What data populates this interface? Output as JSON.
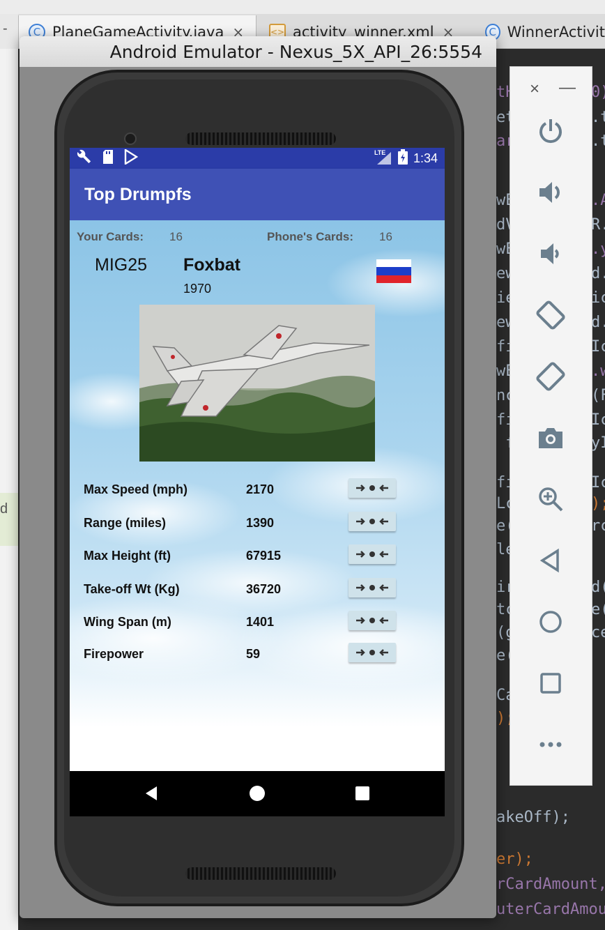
{
  "ide": {
    "tabs": [
      {
        "label": "PlaneGameActivity.java",
        "icon": "class-icon",
        "icon_glyph": "C",
        "active": true
      },
      {
        "label": "activity_winner.xml",
        "icon": "xml-file-icon",
        "icon_glyph": "<>",
        "active": false
      },
      {
        "label": "WinnerActivit",
        "icon": "class-icon",
        "icon_glyph": "C",
        "active": false
      }
    ],
    "close_glyph": "×",
    "left_tab_glyph": "-",
    "gutter_text": "d",
    "code_fragments": [
      {
        "text": "tH",
        "cls": "purple"
      },
      {
        "text": "et",
        "cls": ""
      },
      {
        "text": "ar",
        "cls": "purple"
      },
      {
        "text": "wE",
        "cls": ""
      },
      {
        "text": "dV",
        "cls": ""
      },
      {
        "text": "wE",
        "cls": ""
      },
      {
        "text": "ew",
        "cls": ""
      },
      {
        "text": "ie",
        "cls": ""
      },
      {
        "text": "ew",
        "cls": ""
      },
      {
        "text": "fi",
        "cls": ""
      },
      {
        "text": "wE",
        "cls": ""
      },
      {
        "text": "nc",
        "cls": ""
      },
      {
        "text": "fi",
        "cls": ""
      },
      {
        "text": " f",
        "cls": ""
      },
      {
        "text": "fi",
        "cls": ""
      },
      {
        "text": "Lc",
        "cls": ""
      },
      {
        "text": "e(",
        "cls": ""
      },
      {
        "text": "le",
        "cls": ""
      },
      {
        "text": "ir",
        "cls": ""
      },
      {
        "text": "tc",
        "cls": ""
      },
      {
        "text": "(g",
        "cls": ""
      },
      {
        "text": "e(",
        "cls": ""
      },
      {
        "text": "Ca",
        "cls": ""
      },
      {
        "text": ");",
        "cls": "orange"
      },
      {
        "text": "akeOff);",
        "cls": ""
      },
      {
        "text": "er);",
        "cls": "orange"
      },
      {
        "text": "rCardAmount,",
        "cls": "purple"
      },
      {
        "text": "uterCardAmou",
        "cls": "purple"
      }
    ],
    "code_right": [
      {
        "text": "0)",
        "cls": "purple"
      },
      {
        "text": ".t",
        "cls": ""
      },
      {
        "text": ".t",
        "cls": ""
      },
      {
        "text": ".A",
        "cls": "purple"
      },
      {
        "text": "R.",
        "cls": ""
      },
      {
        "text": ".y",
        "cls": "purple"
      },
      {
        "text": "d.",
        "cls": ""
      },
      {
        "text": "ic",
        "cls": ""
      },
      {
        "text": "d.",
        "cls": ""
      },
      {
        "text": "Ic",
        "cls": ""
      },
      {
        "text": ".w",
        "cls": "purple"
      },
      {
        "text": "(F",
        "cls": ""
      },
      {
        "text": "Ic",
        "cls": ""
      },
      {
        "text": "yI",
        "cls": ""
      },
      {
        "text": "Ic",
        "cls": ""
      },
      {
        "text": ");",
        "cls": "orange"
      },
      {
        "text": "rc",
        "cls": ""
      },
      {
        "text": "d(",
        "cls": ""
      },
      {
        "text": "e(",
        "cls": ""
      },
      {
        "text": "ce",
        "cls": ""
      }
    ]
  },
  "emulator": {
    "title": "Android Emulator - Nexus_5X_API_26:5554",
    "toolbar": {
      "close_glyph": "×",
      "minimize_glyph": "—",
      "buttons": [
        {
          "name": "power-icon"
        },
        {
          "name": "volume-up-icon"
        },
        {
          "name": "volume-down-icon"
        },
        {
          "name": "rotate-left-icon"
        },
        {
          "name": "rotate-right-icon"
        },
        {
          "name": "camera-icon"
        },
        {
          "name": "zoom-icon"
        },
        {
          "name": "back-icon"
        },
        {
          "name": "home-icon"
        },
        {
          "name": "overview-icon"
        },
        {
          "name": "more-icon"
        }
      ]
    }
  },
  "phone": {
    "status": {
      "time": "1:34",
      "network": "LTE",
      "left_icons": [
        "wrench-icon",
        "sd-card-icon",
        "play-store-icon"
      ]
    },
    "app_title": "Top Drumpfs",
    "your_cards_label": "Your Cards:",
    "your_cards_count": "16",
    "phone_cards_label": "Phone's Cards:",
    "phone_cards_count": "16",
    "plane_code": "MIG25",
    "plane_name": "Foxbat",
    "plane_year": "1970",
    "flag_colors": [
      "#ffffff",
      "#1c3ec9",
      "#e0242b"
    ],
    "stats": [
      {
        "label": "Max Speed (mph)",
        "value": "2170"
      },
      {
        "label": "Range (miles)",
        "value": "1390"
      },
      {
        "label": "Max Height (ft)",
        "value": "67915"
      },
      {
        "label": "Take-off Wt (Kg)",
        "value": "36720"
      },
      {
        "label": "Wing Span (m)",
        "value": "1401"
      },
      {
        "label": "Firepower",
        "value": "59"
      }
    ],
    "stat_button_glyph": "➜●⟵"
  },
  "colors": {
    "status_bar": "#2b3ca8",
    "app_bar": "#3f51b5"
  }
}
